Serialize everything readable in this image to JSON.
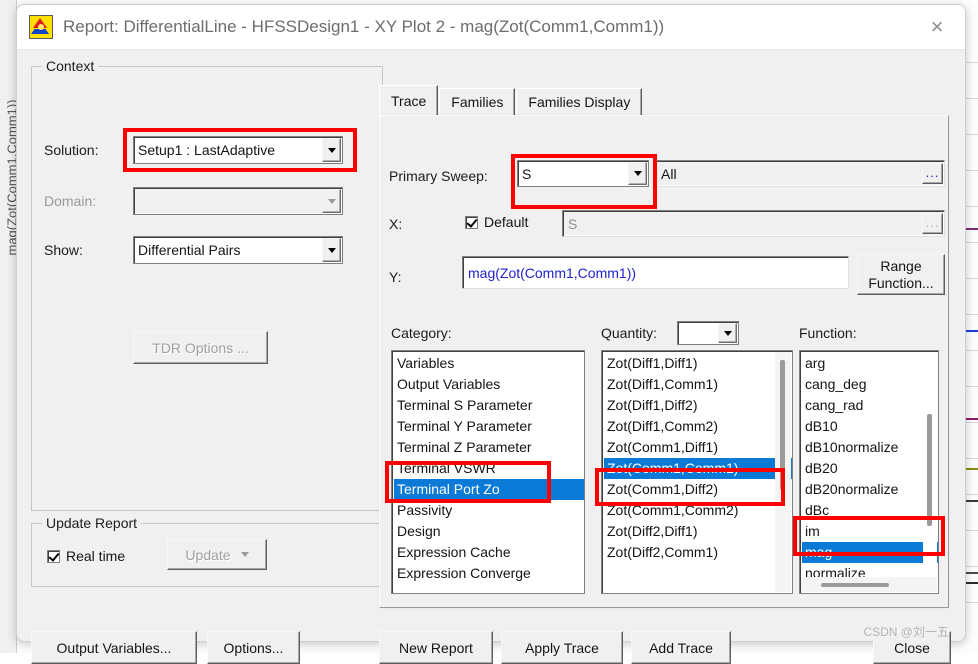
{
  "background": {
    "vertical_label": "mag(Zot(Comm1,Comm1))"
  },
  "window": {
    "title": "Report: DifferentialLine - HFSSDesign1 - XY Plot 2 - mag(Zot(Comm1,Comm1))",
    "app_icon": "hfss-icon",
    "close_icon": "×"
  },
  "context": {
    "group_title": "Context",
    "solution_label": "Solution:",
    "solution_value": "Setup1 : LastAdaptive",
    "domain_label": "Domain:",
    "domain_value": "",
    "show_label": "Show:",
    "show_value": "Differential Pairs",
    "tdr_options_label": "TDR Options ..."
  },
  "update_report": {
    "group_title": "Update Report",
    "real_time_label": "Real time",
    "real_time_checked": true,
    "update_label": "Update"
  },
  "left_buttons": {
    "output_variables": "Output Variables...",
    "options": "Options..."
  },
  "tabs": [
    {
      "label": "Trace",
      "active": true
    },
    {
      "label": "Families",
      "active": false
    },
    {
      "label": "Families Display",
      "active": false
    }
  ],
  "trace": {
    "primary_sweep_label": "Primary Sweep:",
    "primary_sweep_value": "S",
    "primary_sweep_range": "All",
    "range_ellipsis": "...",
    "x_label": "X:",
    "x_default_label": "Default",
    "x_default_checked": true,
    "x_value": "S",
    "x_ellipsis": "...",
    "y_label": "Y:",
    "y_value": "mag(Zot(Comm1,Comm1))",
    "range_function_line1": "Range",
    "range_function_line2": "Function..."
  },
  "category": {
    "label": "Category:",
    "items": [
      "Variables",
      "Output Variables",
      "Terminal S Parameter",
      "Terminal Y Parameter",
      "Terminal Z Parameter",
      "Terminal VSWR",
      "Terminal Port Zo",
      "Passivity",
      "Design",
      "Expression Cache",
      "Expression Converge"
    ],
    "selected": "Terminal Port Zo"
  },
  "quantity": {
    "label": "Quantity:",
    "combo_value": "",
    "items": [
      "Zot(Diff1,Diff1)",
      "Zot(Diff1,Comm1)",
      "Zot(Diff1,Diff2)",
      "Zot(Diff1,Comm2)",
      "Zot(Comm1,Diff1)",
      "Zot(Comm1,Comm1)",
      "Zot(Comm1,Diff2)",
      "Zot(Comm1,Comm2)",
      "Zot(Diff2,Diff1)",
      "Zot(Diff2,Comm1)"
    ],
    "selected": "Zot(Comm1,Comm1)"
  },
  "function": {
    "label": "Function:",
    "items": [
      "arg",
      "cang_deg",
      "cang_rad",
      "dB10",
      "dB10normalize",
      "dB20",
      "dB20normalize",
      "dBc",
      "im",
      "mag",
      "normalize"
    ],
    "selected": "mag"
  },
  "bottom_buttons": {
    "new_report": "New Report",
    "apply_trace": "Apply Trace",
    "add_trace": "Add Trace",
    "close": "Close"
  },
  "watermark": "CSDN @刘一五",
  "colors": {
    "highlight": "#fe0000",
    "selection": "#0b7ad6",
    "expression_text": "#2222cc",
    "dialog_bg": "#f0f0f0"
  }
}
